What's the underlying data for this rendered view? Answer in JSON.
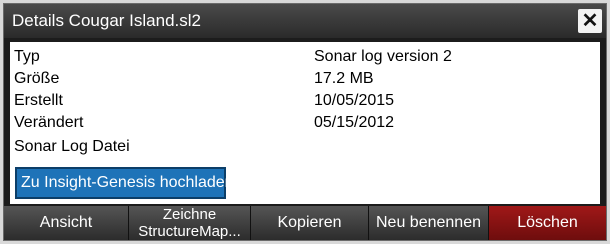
{
  "dialog": {
    "title": "Details Cougar Island.sl2",
    "close_label": "✕"
  },
  "details": [
    {
      "label": "Typ",
      "value": "Sonar log version 2"
    },
    {
      "label": "Größe",
      "value": "17.2 MB"
    },
    {
      "label": "Erstellt",
      "value": "10/05/2015"
    },
    {
      "label": "Verändert",
      "value": "05/15/2012"
    },
    {
      "label": "Sonar Log Datei",
      "value": ""
    }
  ],
  "upload_button": "Zu Insight-Genesis hochladen",
  "toolbar": {
    "view": "Ansicht",
    "draw_line1": "Zeichne",
    "draw_line2": "StructureMap...",
    "copy": "Kopieren",
    "rename": "Neu benennen",
    "delete": "Löschen"
  }
}
